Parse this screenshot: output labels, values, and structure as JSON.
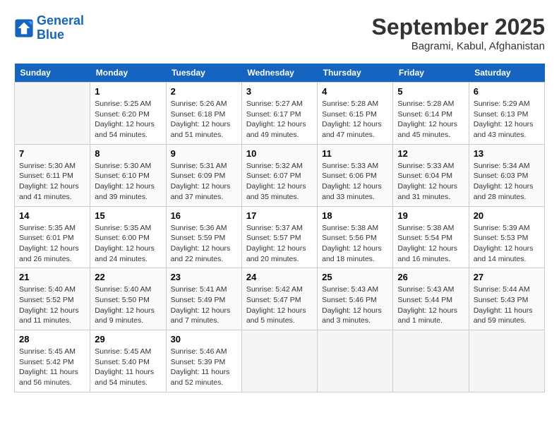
{
  "header": {
    "logo_line1": "General",
    "logo_line2": "Blue",
    "month": "September 2025",
    "location": "Bagrami, Kabul, Afghanistan"
  },
  "weekdays": [
    "Sunday",
    "Monday",
    "Tuesday",
    "Wednesday",
    "Thursday",
    "Friday",
    "Saturday"
  ],
  "weeks": [
    [
      {
        "day": "",
        "info": ""
      },
      {
        "day": "1",
        "info": "Sunrise: 5:25 AM\nSunset: 6:20 PM\nDaylight: 12 hours\nand 54 minutes."
      },
      {
        "day": "2",
        "info": "Sunrise: 5:26 AM\nSunset: 6:18 PM\nDaylight: 12 hours\nand 51 minutes."
      },
      {
        "day": "3",
        "info": "Sunrise: 5:27 AM\nSunset: 6:17 PM\nDaylight: 12 hours\nand 49 minutes."
      },
      {
        "day": "4",
        "info": "Sunrise: 5:28 AM\nSunset: 6:15 PM\nDaylight: 12 hours\nand 47 minutes."
      },
      {
        "day": "5",
        "info": "Sunrise: 5:28 AM\nSunset: 6:14 PM\nDaylight: 12 hours\nand 45 minutes."
      },
      {
        "day": "6",
        "info": "Sunrise: 5:29 AM\nSunset: 6:13 PM\nDaylight: 12 hours\nand 43 minutes."
      }
    ],
    [
      {
        "day": "7",
        "info": "Sunrise: 5:30 AM\nSunset: 6:11 PM\nDaylight: 12 hours\nand 41 minutes."
      },
      {
        "day": "8",
        "info": "Sunrise: 5:30 AM\nSunset: 6:10 PM\nDaylight: 12 hours\nand 39 minutes."
      },
      {
        "day": "9",
        "info": "Sunrise: 5:31 AM\nSunset: 6:09 PM\nDaylight: 12 hours\nand 37 minutes."
      },
      {
        "day": "10",
        "info": "Sunrise: 5:32 AM\nSunset: 6:07 PM\nDaylight: 12 hours\nand 35 minutes."
      },
      {
        "day": "11",
        "info": "Sunrise: 5:33 AM\nSunset: 6:06 PM\nDaylight: 12 hours\nand 33 minutes."
      },
      {
        "day": "12",
        "info": "Sunrise: 5:33 AM\nSunset: 6:04 PM\nDaylight: 12 hours\nand 31 minutes."
      },
      {
        "day": "13",
        "info": "Sunrise: 5:34 AM\nSunset: 6:03 PM\nDaylight: 12 hours\nand 28 minutes."
      }
    ],
    [
      {
        "day": "14",
        "info": "Sunrise: 5:35 AM\nSunset: 6:01 PM\nDaylight: 12 hours\nand 26 minutes."
      },
      {
        "day": "15",
        "info": "Sunrise: 5:35 AM\nSunset: 6:00 PM\nDaylight: 12 hours\nand 24 minutes."
      },
      {
        "day": "16",
        "info": "Sunrise: 5:36 AM\nSunset: 5:59 PM\nDaylight: 12 hours\nand 22 minutes."
      },
      {
        "day": "17",
        "info": "Sunrise: 5:37 AM\nSunset: 5:57 PM\nDaylight: 12 hours\nand 20 minutes."
      },
      {
        "day": "18",
        "info": "Sunrise: 5:38 AM\nSunset: 5:56 PM\nDaylight: 12 hours\nand 18 minutes."
      },
      {
        "day": "19",
        "info": "Sunrise: 5:38 AM\nSunset: 5:54 PM\nDaylight: 12 hours\nand 16 minutes."
      },
      {
        "day": "20",
        "info": "Sunrise: 5:39 AM\nSunset: 5:53 PM\nDaylight: 12 hours\nand 14 minutes."
      }
    ],
    [
      {
        "day": "21",
        "info": "Sunrise: 5:40 AM\nSunset: 5:52 PM\nDaylight: 12 hours\nand 11 minutes."
      },
      {
        "day": "22",
        "info": "Sunrise: 5:40 AM\nSunset: 5:50 PM\nDaylight: 12 hours\nand 9 minutes."
      },
      {
        "day": "23",
        "info": "Sunrise: 5:41 AM\nSunset: 5:49 PM\nDaylight: 12 hours\nand 7 minutes."
      },
      {
        "day": "24",
        "info": "Sunrise: 5:42 AM\nSunset: 5:47 PM\nDaylight: 12 hours\nand 5 minutes."
      },
      {
        "day": "25",
        "info": "Sunrise: 5:43 AM\nSunset: 5:46 PM\nDaylight: 12 hours\nand 3 minutes."
      },
      {
        "day": "26",
        "info": "Sunrise: 5:43 AM\nSunset: 5:44 PM\nDaylight: 12 hours\nand 1 minute."
      },
      {
        "day": "27",
        "info": "Sunrise: 5:44 AM\nSunset: 5:43 PM\nDaylight: 11 hours\nand 59 minutes."
      }
    ],
    [
      {
        "day": "28",
        "info": "Sunrise: 5:45 AM\nSunset: 5:42 PM\nDaylight: 11 hours\nand 56 minutes."
      },
      {
        "day": "29",
        "info": "Sunrise: 5:45 AM\nSunset: 5:40 PM\nDaylight: 11 hours\nand 54 minutes."
      },
      {
        "day": "30",
        "info": "Sunrise: 5:46 AM\nSunset: 5:39 PM\nDaylight: 11 hours\nand 52 minutes."
      },
      {
        "day": "",
        "info": ""
      },
      {
        "day": "",
        "info": ""
      },
      {
        "day": "",
        "info": ""
      },
      {
        "day": "",
        "info": ""
      }
    ]
  ]
}
